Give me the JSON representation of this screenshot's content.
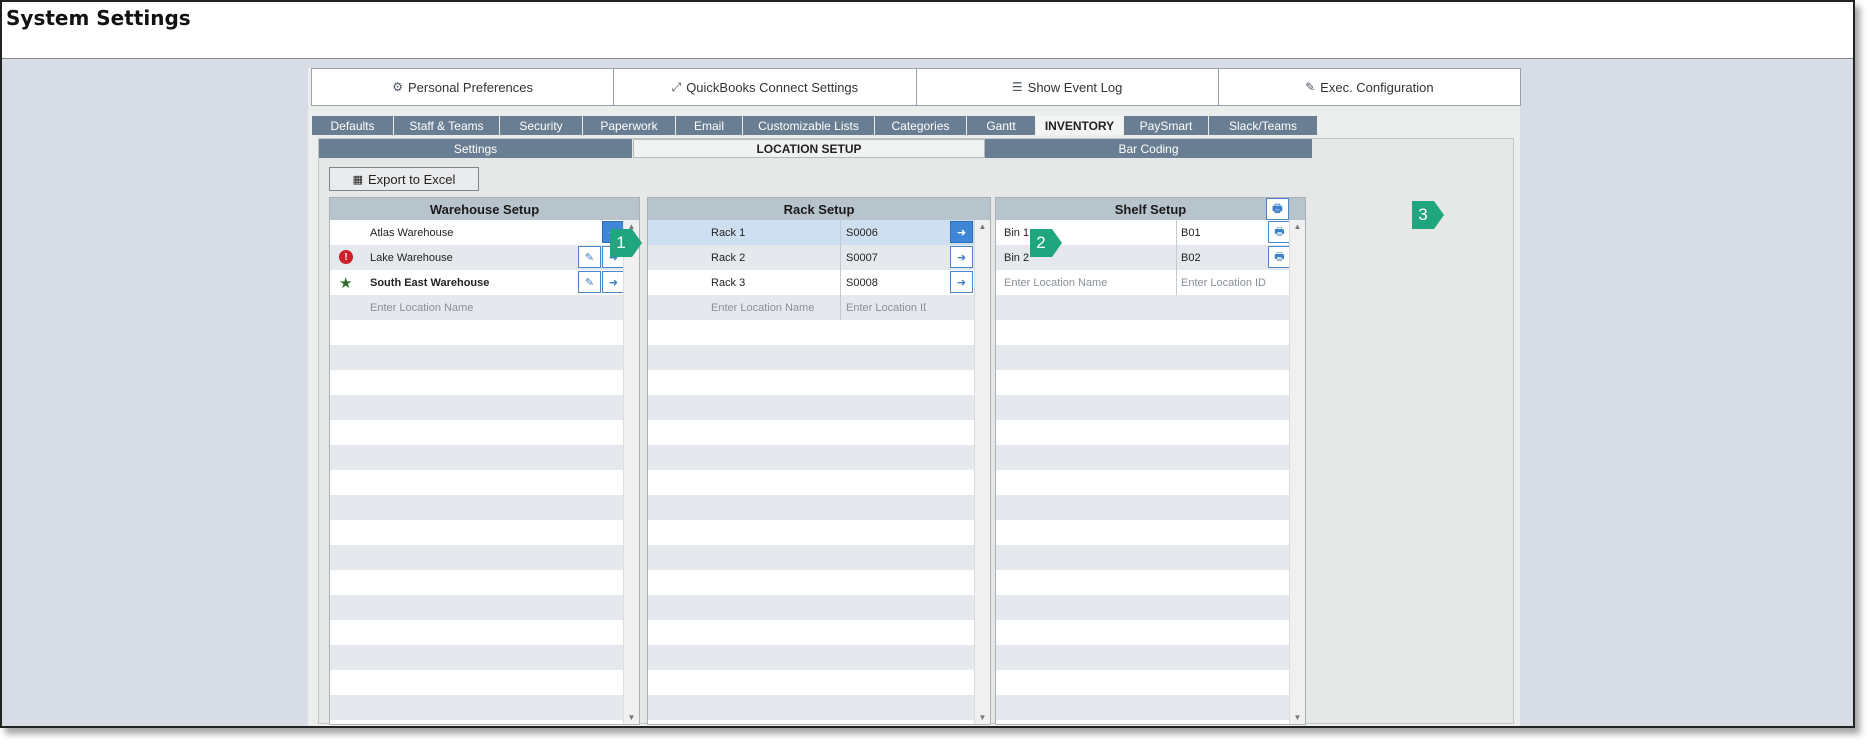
{
  "window": {
    "title": "System Settings"
  },
  "top_buttons": [
    {
      "label": "Personal Preferences",
      "icon": "gear-icon"
    },
    {
      "label": "QuickBooks Connect Settings",
      "icon": "expand-icon"
    },
    {
      "label": "Show Event Log",
      "icon": "list-icon"
    },
    {
      "label": "Exec. Configuration",
      "icon": "edit-icon"
    }
  ],
  "main_tabs": [
    {
      "label": "Defaults"
    },
    {
      "label": "Staff & Teams"
    },
    {
      "label": "Security"
    },
    {
      "label": "Paperwork"
    },
    {
      "label": "Email"
    },
    {
      "label": "Customizable Lists"
    },
    {
      "label": "Categories"
    },
    {
      "label": "Gantt"
    },
    {
      "label": "INVENTORY",
      "active": true
    },
    {
      "label": "PaySmart"
    },
    {
      "label": "Slack/Teams"
    }
  ],
  "sub_tabs": [
    {
      "label": "Settings"
    },
    {
      "label": "LOCATION SETUP",
      "active": true
    },
    {
      "label": "Bar Coding"
    }
  ],
  "export": {
    "label": "Export to Excel"
  },
  "warehouse": {
    "title": "Warehouse Setup",
    "items": [
      {
        "name": "Atlas Warehouse",
        "status": ""
      },
      {
        "name": "Lake Warehouse",
        "status": "error"
      },
      {
        "name": "South East Warehouse",
        "status": "star"
      }
    ],
    "placeholder": "Enter Location Name"
  },
  "rack": {
    "title": "Rack Setup",
    "items": [
      {
        "name": "Rack 1",
        "id": "S0006"
      },
      {
        "name": "Rack 2",
        "id": "S0007"
      },
      {
        "name": "Rack 3",
        "id": "S0008"
      }
    ],
    "placeholder_name": "Enter Location Name",
    "placeholder_id": "Enter Location ID"
  },
  "shelf": {
    "title": "Shelf Setup",
    "items": [
      {
        "name": "Bin 1",
        "id": "B01"
      },
      {
        "name": "Bin 2",
        "id": "B02"
      }
    ],
    "placeholder_name": "Enter Location Name",
    "placeholder_id": "Enter Location ID"
  },
  "callouts": [
    "1",
    "2",
    "3"
  ],
  "colors": {
    "tab_bg": "#6a7e93",
    "panel_header": "#b8c4cc",
    "action_blue": "#3f86d6",
    "callout_green": "#1fa67e",
    "error_red": "#d0202a",
    "star_green": "#2f6f2a"
  }
}
